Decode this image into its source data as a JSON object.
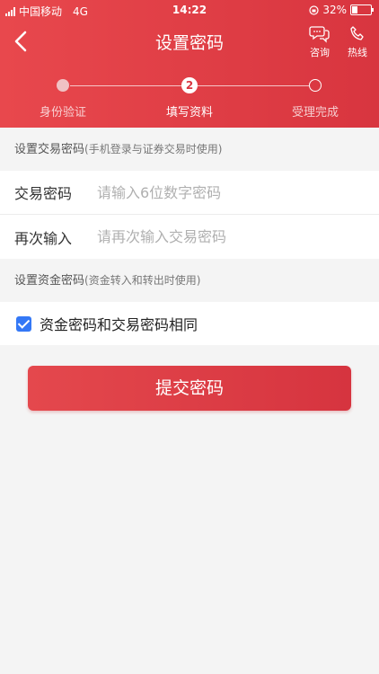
{
  "status_bar": {
    "carrier": "中国移动",
    "network": "4G",
    "time": "14:22",
    "battery": "32%",
    "battery_level": 0.32
  },
  "nav": {
    "title": "设置密码",
    "consult_label": "咨询",
    "hotline_label": "热线"
  },
  "steps": [
    {
      "label": "身份验证",
      "state": "done"
    },
    {
      "label": "填写资料",
      "state": "current",
      "number": "2"
    },
    {
      "label": "受理完成",
      "state": "todo"
    }
  ],
  "trade_section": {
    "title": "设置交易密码",
    "note": "(手机登录与证券交易时使用)",
    "fields": [
      {
        "label": "交易密码",
        "placeholder": "请输入6位数字密码",
        "value": ""
      },
      {
        "label": "再次输入",
        "placeholder": "请再次输入交易密码",
        "value": ""
      }
    ]
  },
  "fund_section": {
    "title": "设置资金密码",
    "note": "(资金转入和转出时使用)",
    "same_checkbox_label": "资金密码和交易密码相同",
    "same_checked": true
  },
  "submit_label": "提交密码",
  "colors": {
    "brand_red": "#d8353f",
    "checkbox_blue": "#3478f6"
  }
}
